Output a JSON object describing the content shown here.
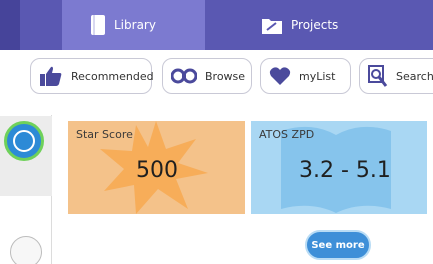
{
  "topbar": {
    "tabs": [
      {
        "label": "Library",
        "icon": "book-icon",
        "active": true
      },
      {
        "label": "Projects",
        "icon": "folder-icon",
        "active": false
      }
    ]
  },
  "filters": {
    "items": [
      {
        "label": "Recommended",
        "icon": "thumbs-up-icon"
      },
      {
        "label": "Browse",
        "icon": "binoculars-icon"
      },
      {
        "label": "myList",
        "icon": "heart-icon"
      },
      {
        "label": "Search",
        "icon": "search-icon"
      }
    ]
  },
  "cards": {
    "star": {
      "label": "Star Score",
      "value": "500"
    },
    "atos": {
      "label": "ATOS ZPD",
      "value": "3.2 - 5.1"
    }
  },
  "actions": {
    "see_more": "See more"
  },
  "colors": {
    "topbar": "#5a58b2",
    "active_tab": "#7c7ad0",
    "star_card": "#f4c28a",
    "atos_card": "#a9d7f3",
    "accent": "#3e8fd8"
  }
}
